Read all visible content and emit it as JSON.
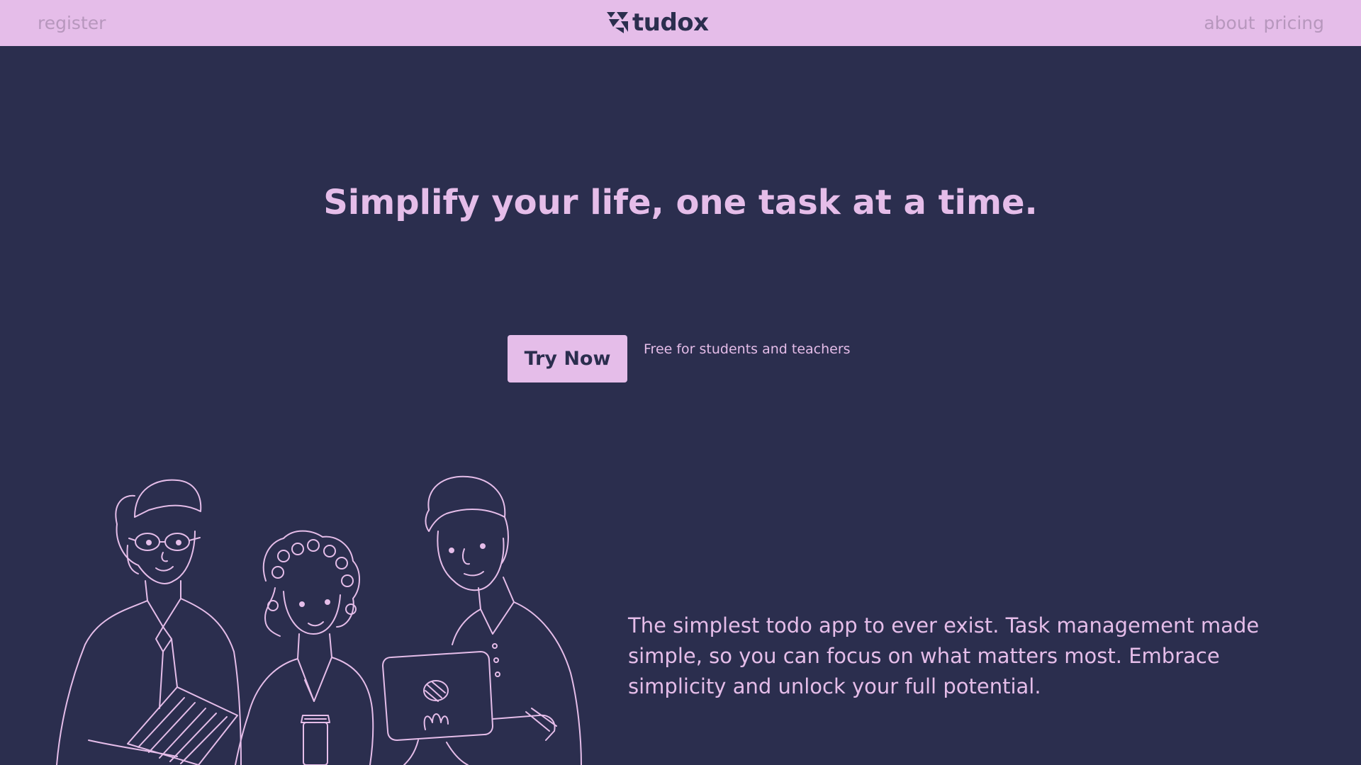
{
  "nav": {
    "register": "register",
    "about": "about",
    "pricing": "pricing"
  },
  "brand": {
    "name": "tudox"
  },
  "hero": {
    "headline": "Simplify your life, one task at a time.",
    "cta_label": "Try Now",
    "cta_note": "Free for students and teachers"
  },
  "description": "The simplest todo app to ever exist. Task management made simple, so you can focus on what matters most. Embrace simplicity and unlock your full potential.",
  "colors": {
    "background": "#2b2e4e",
    "accent": "#e5bde9",
    "nav_link": "#b797bd"
  }
}
